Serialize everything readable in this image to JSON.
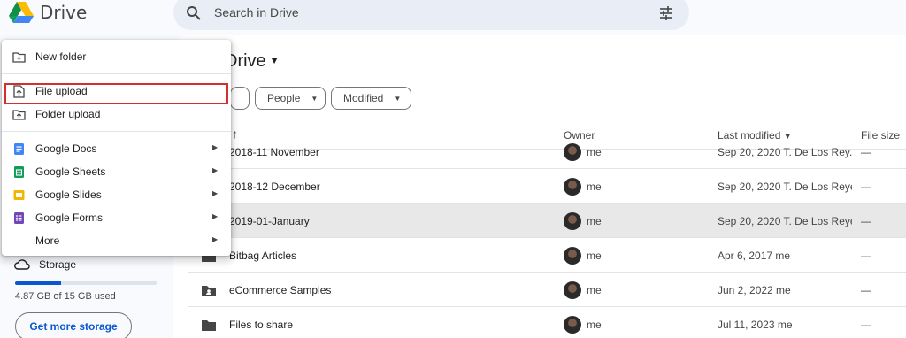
{
  "app": {
    "name": "Drive",
    "search_placeholder": "Search in Drive"
  },
  "page": {
    "title": "Drive"
  },
  "filters": [
    {
      "label": "People"
    },
    {
      "label": "Modified"
    }
  ],
  "columns": {
    "owner": "Owner",
    "last_modified": "Last modified",
    "file_size": "File size"
  },
  "files": [
    {
      "name": "2018-11 November",
      "owner": "me",
      "modified": "Sep 20, 2020 T. De Los Rey...",
      "size": "—"
    },
    {
      "name": "2018-12 December",
      "owner": "me",
      "modified": "Sep 20, 2020 T. De Los Reyes",
      "size": "—"
    },
    {
      "name": "2019-01-January",
      "owner": "me",
      "modified": "Sep 20, 2020 T. De Los Reyes",
      "size": "—"
    },
    {
      "name": "Bitbag Articles",
      "owner": "me",
      "modified": "Apr 6, 2017 me",
      "size": "—"
    },
    {
      "name": "eCommerce Samples",
      "owner": "me",
      "modified": "Jun 2, 2022 me",
      "size": "—"
    },
    {
      "name": "Files to share",
      "owner": "me",
      "modified": "Jul 11, 2023 me",
      "size": "—"
    }
  ],
  "menu": {
    "new_folder": "New folder",
    "file_upload": "File upload",
    "folder_upload": "Folder upload",
    "google_docs": "Google Docs",
    "google_sheets": "Google Sheets",
    "google_slides": "Google Slides",
    "google_forms": "Google Forms",
    "more": "More"
  },
  "storage": {
    "label": "Storage",
    "usage_text": "4.87 GB of 15 GB used",
    "used_fraction": 0.325,
    "button": "Get more storage"
  },
  "colors": {
    "accent": "#0b57d0",
    "highlight_box": "#d32f2f",
    "docs": "#4285f4",
    "sheets": "#0f9d58",
    "slides": "#f4b400",
    "forms": "#7248b9"
  }
}
